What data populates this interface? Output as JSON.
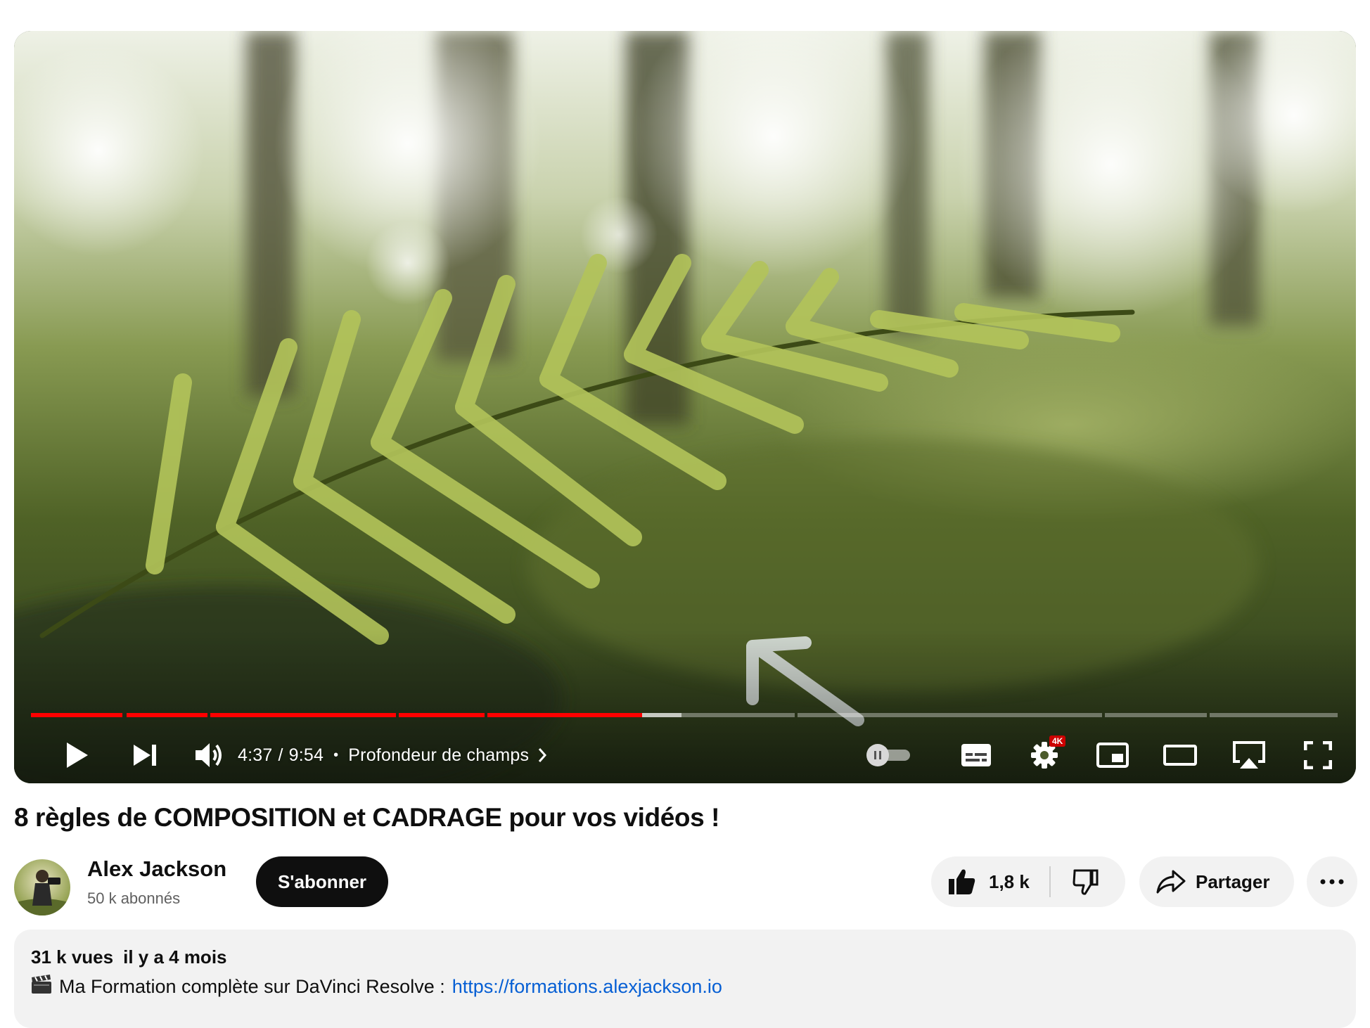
{
  "player": {
    "time": {
      "current": "4:37",
      "separator": "/",
      "duration": "9:54",
      "bullet": "•",
      "chapter": "Profondeur de champs"
    },
    "playback_progress": 0.466,
    "buffered_progress": 0.496,
    "quality_badge": "4K",
    "accent_color": "#ff0000",
    "icons": [
      "play-icon",
      "next-icon",
      "volume-icon",
      "chevron-right-icon",
      "autoplay-pause-icon",
      "subtitles-icon",
      "settings-icon",
      "miniplayer-icon",
      "theater-mode-icon",
      "airplay-icon",
      "fullscreen-icon"
    ]
  },
  "video": {
    "title": "8 règles de COMPOSITION et CADRAGE pour vos vidéos !"
  },
  "channel": {
    "name": "Alex Jackson",
    "subscribers": "50 k abonnés",
    "subscribe_label": "S'abonner"
  },
  "actions": {
    "likes": "1,8 k",
    "share_label": "Partager",
    "more_label": "···"
  },
  "description": {
    "views": "31 k vues",
    "ago": "il y a 4 mois",
    "line_text": "Ma Formation complète sur DaVinci Resolve :",
    "link": "https://formations.alexjackson.io",
    "link_color": "#065fd4"
  }
}
